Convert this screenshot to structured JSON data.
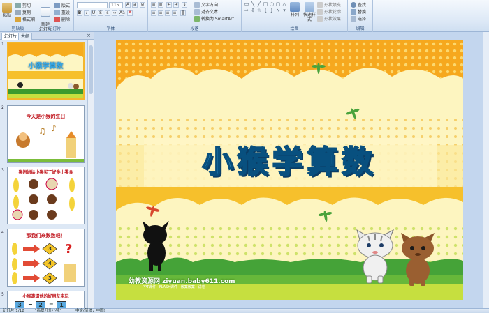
{
  "ribbon": {
    "groups": {
      "clipboard": "剪贴板",
      "slides": "幻灯片",
      "font": "字体",
      "paragraph": "段落",
      "drawing": "绘图",
      "editing": "编辑"
    },
    "paste": "粘贴",
    "cut": "剪切",
    "copy": "复制",
    "format_painter": "格式刷",
    "new_slide": "新建\n幻灯片",
    "layout": "版式",
    "reset": "重设",
    "delete": "删除",
    "font_name": "",
    "font_size": "115",
    "text_direction": "文字方向",
    "align_text": "对齐文本",
    "convert_smartart": "转换为 SmartArt",
    "arrange": "排列",
    "quick_styles": "快速样式",
    "shape_fill": "形状填充",
    "shape_outline": "形状轮廓",
    "shape_effects": "形状效果",
    "find": "查找",
    "replace": "替换",
    "select": "选择"
  },
  "left_pane": {
    "tab_slides": "幻灯片",
    "tab_outline": "大纲",
    "close": "×",
    "thumbnails": [
      {
        "num": "1",
        "title": "小猴学算数"
      },
      {
        "num": "2",
        "title": "今天是小猴的生日"
      },
      {
        "num": "3",
        "title": "猴妈妈给小猴买了好多小零食"
      },
      {
        "num": "4",
        "title": "那我们来数数吧！"
      },
      {
        "num": "5",
        "title": "小猴邀请他的好朋友来玩"
      }
    ],
    "thumb4_numbers": [
      "3",
      "4",
      "3"
    ],
    "thumb5_numbers": [
      "3",
      "2",
      "1"
    ]
  },
  "slide": {
    "title": "小猴学算数",
    "footer_brand": "幼教资源网 ziyuan.baby611.com",
    "footer_tagline": "PPT课件 · FLASH课件 · 教案教案 · 试卷"
  },
  "status": {
    "slide_pos": "幻灯片 1/12",
    "theme": "\"翡翠开升小镜\"",
    "language": "中文(简体，中国)"
  }
}
